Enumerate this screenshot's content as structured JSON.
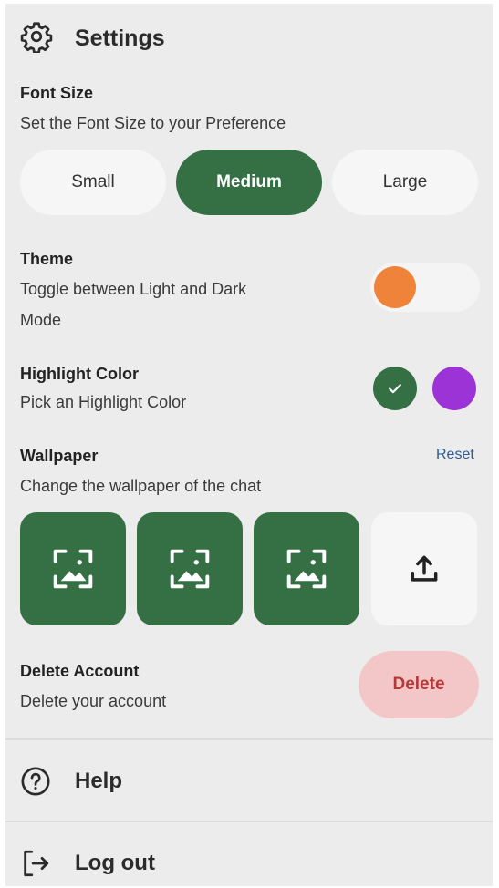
{
  "header": {
    "title": "Settings",
    "icon": "gear-icon"
  },
  "font_size": {
    "title": "Font Size",
    "description": "Set the Font Size to your Preference",
    "options": [
      "Small",
      "Medium",
      "Large"
    ],
    "selected": "Medium"
  },
  "theme": {
    "title": "Theme",
    "description_line1": "Toggle between Light and Dark",
    "description_line2": "Mode",
    "knob_color": "#f0833a"
  },
  "highlight": {
    "title": "Highlight Color",
    "description": "Pick an Highlight Color",
    "colors": [
      "#357045",
      "#9b33d6"
    ],
    "selected": "#357045"
  },
  "wallpaper": {
    "title": "Wallpaper",
    "description": "Change the wallpaper of the chat",
    "reset_label": "Reset"
  },
  "delete_account": {
    "title": "Delete Account",
    "description": "Delete your account",
    "button_label": "Delete"
  },
  "menu": {
    "help_label": "Help",
    "logout_label": "Log out"
  },
  "colors": {
    "accent": "#357045",
    "panel_bg": "#ececec",
    "delete_bg": "#f3c7c7",
    "delete_text": "#b73838",
    "link": "#2f5a9a"
  }
}
